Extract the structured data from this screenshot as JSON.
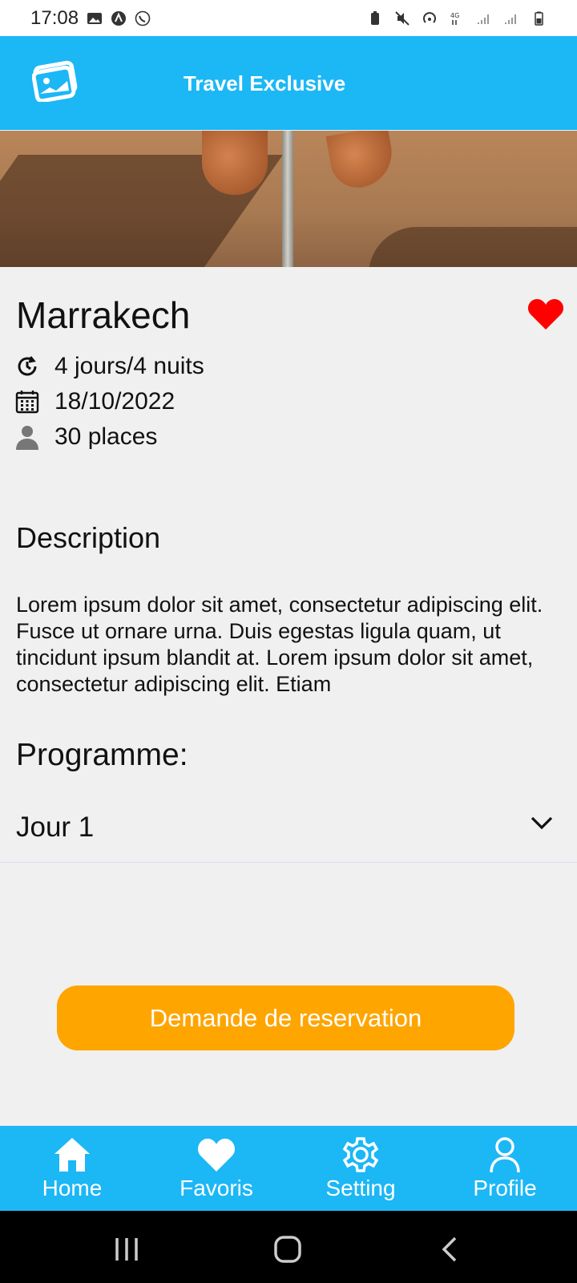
{
  "status_bar": {
    "time": "17:08"
  },
  "app_bar": {
    "title": "Travel Exclusive"
  },
  "trip": {
    "title": "Marrakech",
    "duration": "4 jours/4 nuits",
    "date": "18/10/2022",
    "places": "30 places"
  },
  "description": {
    "heading": "Description",
    "text": "Lorem ipsum dolor sit amet, consectetur adipiscing elit. Fusce ut ornare urna. Duis egestas ligula quam, ut tincidunt ipsum blandit at. Lorem ipsum dolor sit amet, consectetur adipiscing elit. Etiam"
  },
  "programme": {
    "heading": "Programme:",
    "day_label": "Jour 1"
  },
  "cta": {
    "label": "Demande de reservation"
  },
  "bottom_nav": {
    "items": [
      {
        "label": "Home",
        "icon": "home-icon"
      },
      {
        "label": "Favoris",
        "icon": "heart-icon"
      },
      {
        "label": "Setting",
        "icon": "gear-icon"
      },
      {
        "label": "Profile",
        "icon": "user-icon"
      }
    ]
  },
  "colors": {
    "primary": "#1cb7f5",
    "accent": "#ffa500",
    "favorite": "#ff0000"
  }
}
